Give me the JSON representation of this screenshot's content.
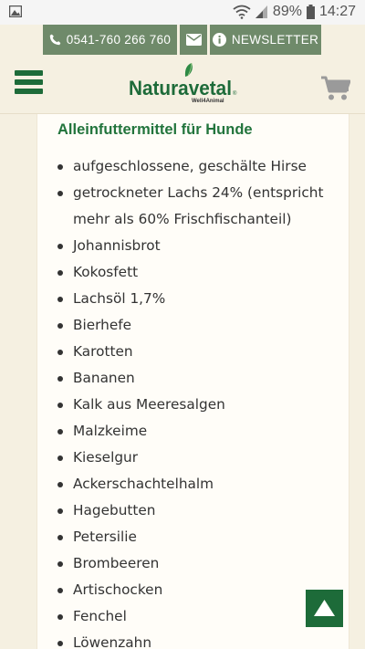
{
  "status_bar": {
    "battery": "89%",
    "time": "14:27",
    "icons": [
      "gallery-icon",
      "wifi-icon",
      "signal-icon",
      "battery-icon"
    ]
  },
  "topbar": {
    "phone": "0541-760 266 760",
    "newsletter": "NEWSLETTER",
    "icons": [
      "phone-icon",
      "mail-icon",
      "info-icon"
    ]
  },
  "header": {
    "logo_text": "Naturavetal",
    "logo_tagline": "Well4Animal",
    "icons": [
      "menu-icon",
      "cart-icon"
    ]
  },
  "content": {
    "heading": "Alleinfuttermittel für Hunde",
    "ingredients": [
      "aufgeschlossene, geschälte Hirse",
      "getrockneter Lachs 24% (entspricht mehr als 60% Frischfischanteil)",
      "Johannisbrot",
      "Kokosfett",
      "Lachsöl 1,7%",
      "Bierhefe",
      "Karotten",
      "Bananen",
      "Kalk aus Meeresalgen",
      "Malzkeime",
      "Kieselgur",
      "Ackerschachtelhalm",
      "Hagebutten",
      "Petersilie",
      "Brombeeren",
      "Artischocken",
      "Fenchel",
      "Löwenzahn"
    ]
  },
  "colors": {
    "brand_green": "#1d6b39",
    "topbar_green": "#6f8a6a",
    "heading_green": "#22743c",
    "background": "#f5f0e1",
    "cart_gray": "#9a9a9a"
  }
}
